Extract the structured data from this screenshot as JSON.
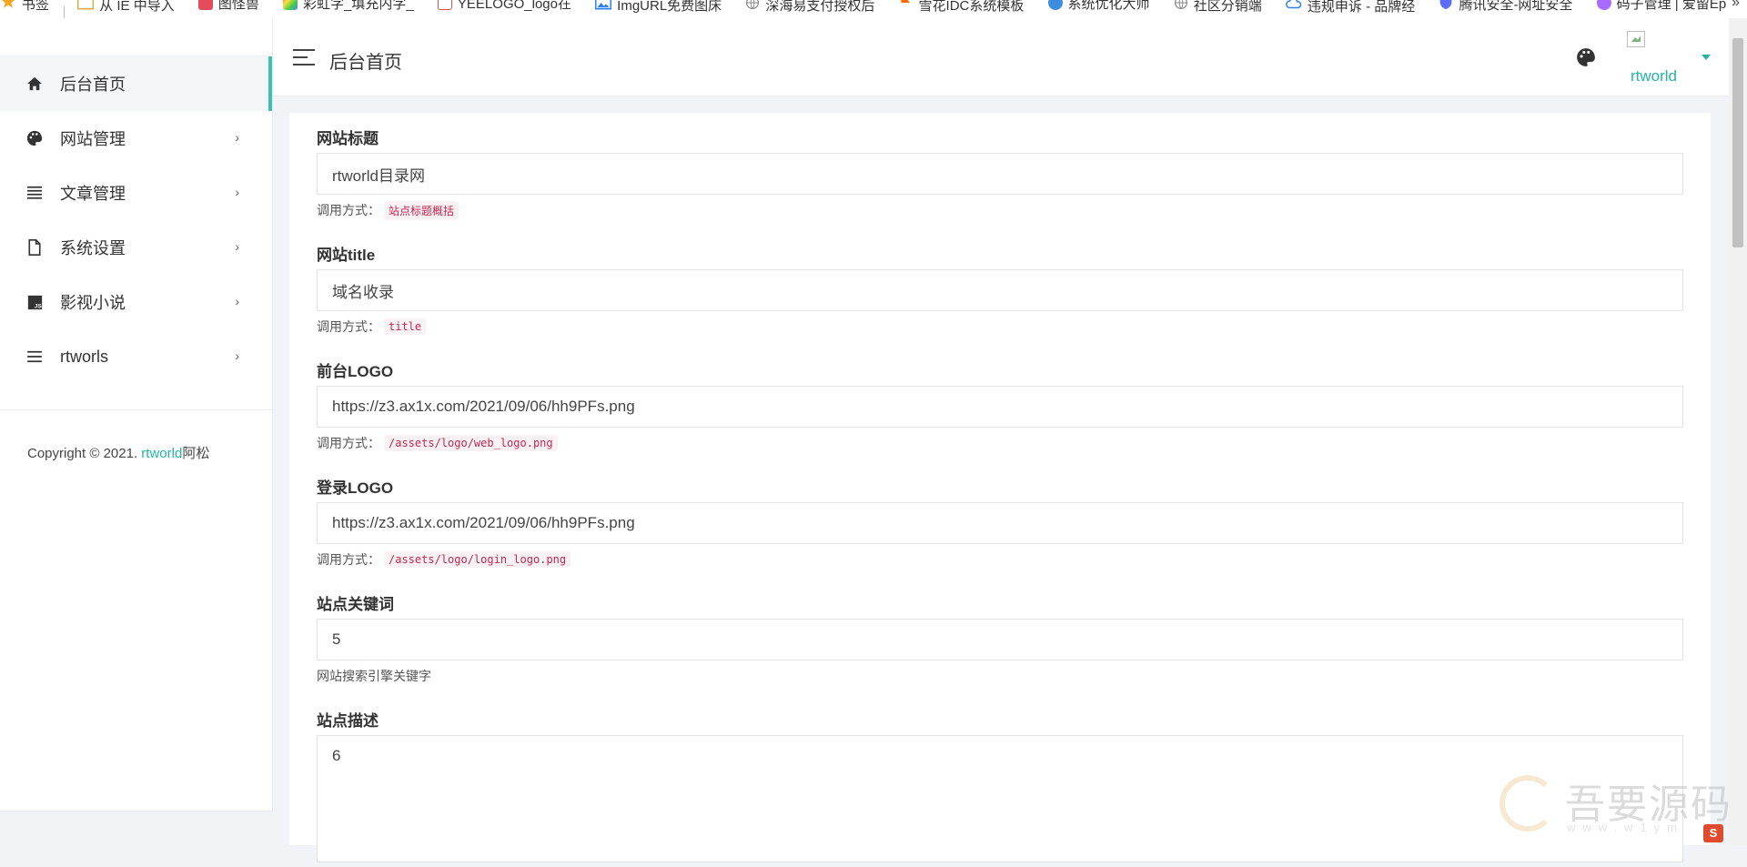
{
  "bookmarks": {
    "items": [
      {
        "label": "书签",
        "icon": "star-icon",
        "color": "#f5a623"
      },
      {
        "label": "从 IE 中导入",
        "icon": "folder-icon",
        "color": "#f7d26b"
      },
      {
        "label": "图怪兽",
        "icon": "site-icon",
        "color": "#e64b5c"
      },
      {
        "label": "彩虹字_填充内字_",
        "icon": "site-icon",
        "color": "#8bc34a"
      },
      {
        "label": "YEELOGO_logo在",
        "icon": "site-icon",
        "color": "#d9534f"
      },
      {
        "label": "ImgURL免费图床",
        "icon": "image-icon",
        "color": "#2f80ed"
      },
      {
        "label": "深海易支付授权后",
        "icon": "globe-icon",
        "color": "#888888"
      },
      {
        "label": "雪花IDC系统模板",
        "icon": "flag-icon",
        "color": "#ff6a00"
      },
      {
        "label": "系统优化大师",
        "icon": "site-icon",
        "color": "#3c8dde"
      },
      {
        "label": "社区分销端",
        "icon": "globe-icon",
        "color": "#888888"
      },
      {
        "label": "违规申诉 - 品牌经",
        "icon": "cloud-icon",
        "color": "#2f80ed"
      },
      {
        "label": "腾讯安全-网址安全",
        "icon": "shield-icon",
        "color": "#5b6dff"
      },
      {
        "label": "码子管理 | 爱留Ep",
        "icon": "site-icon",
        "color": "#a86bff"
      }
    ],
    "more": "»"
  },
  "sidebar": {
    "items": [
      {
        "label": "后台首页",
        "icon": "home-icon",
        "active": true
      },
      {
        "label": "网站管理",
        "icon": "palette-icon"
      },
      {
        "label": "文章管理",
        "icon": "list-icon"
      },
      {
        "label": "系统设置",
        "icon": "file-icon"
      },
      {
        "label": "影视小说",
        "icon": "js-icon"
      },
      {
        "label": "rtworls",
        "icon": "menu-icon"
      }
    ],
    "arrow": "›",
    "copyright_prefix": "Copyright © 2021. ",
    "copyright_brand": "rtworld",
    "copyright_suffix": "阿松"
  },
  "header": {
    "title": "后台首页",
    "username": "rtworld"
  },
  "form": {
    "fields": [
      {
        "label": "网站标题",
        "value": "rtworld目录网",
        "hint": "调用方式：",
        "code": "站点标题概括"
      },
      {
        "label": "网站title",
        "value": "域名收录",
        "hint": "调用方式：",
        "code": "title"
      },
      {
        "label": "前台LOGO",
        "value": "https://z3.ax1x.com/2021/09/06/hh9PFs.png",
        "hint": "调用方式：",
        "code": "/assets/logo/web_logo.png"
      },
      {
        "label": "登录LOGO",
        "value": "https://z3.ax1x.com/2021/09/06/hh9PFs.png",
        "hint": "调用方式：",
        "code": "/assets/logo/login_logo.png"
      },
      {
        "label": "站点关键词",
        "value": "5",
        "hint": "网站搜索引擎关键字"
      },
      {
        "label": "站点描述",
        "value": "6"
      }
    ]
  },
  "watermark": {
    "text": "吾要源码",
    "sub": "www.w1ym"
  },
  "colors": {
    "accent": "#3fc1b1",
    "brand": "#26b3a5",
    "code": "#c7254e"
  }
}
